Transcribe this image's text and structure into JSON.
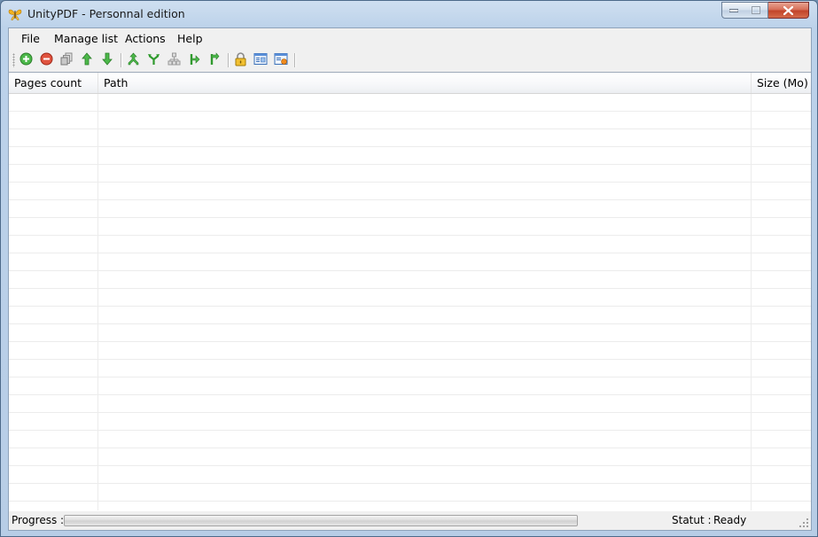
{
  "window": {
    "title": "UnityPDF - Personnal edition",
    "app_icon": "butterfly-app-icon",
    "controls": [
      "minimize-icon",
      "maximize-icon",
      "close-icon"
    ]
  },
  "menubar": {
    "items": [
      {
        "label": "File"
      },
      {
        "label": "Manage list"
      },
      {
        "label": "Actions"
      },
      {
        "label": "Help"
      }
    ]
  },
  "toolbar": {
    "buttons": [
      {
        "icon": "add-file-icon",
        "color": "#3aa63a"
      },
      {
        "icon": "remove-file-icon",
        "color": "#d23a2a"
      },
      {
        "icon": "clear-list-icon",
        "color": "#8a8a8a"
      },
      {
        "icon": "move-up-icon",
        "color": "#3aa63a"
      },
      {
        "icon": "move-down-icon",
        "color": "#3aa63a"
      },
      {
        "icon": "merge-icon",
        "color": "#3aa63a"
      },
      {
        "icon": "split-icon",
        "color": "#3aa63a"
      },
      {
        "icon": "extract-pages-icon",
        "color": "#9a9a9a"
      },
      {
        "icon": "insert-after-icon",
        "color": "#3aa63a"
      },
      {
        "icon": "insert-before-icon",
        "color": "#3aa63a"
      },
      {
        "icon": "lock-icon",
        "color": "#e0a81c"
      },
      {
        "icon": "properties-icon",
        "color": "#3a7bd5"
      },
      {
        "icon": "properties-edit-icon",
        "color": "#3a7bd5"
      }
    ]
  },
  "table": {
    "columns": [
      {
        "label": "Pages count"
      },
      {
        "label": "Path"
      },
      {
        "label": "Size (Mo)"
      }
    ],
    "rows": []
  },
  "statusbar": {
    "progress_label": "Progress :",
    "progress_value": 0,
    "status_label": "Statut :",
    "status_value": "Ready"
  },
  "colors": {
    "accent_green": "#3aa63a",
    "window_frame": "#bcd2ea",
    "close_button": "#c2442a"
  }
}
